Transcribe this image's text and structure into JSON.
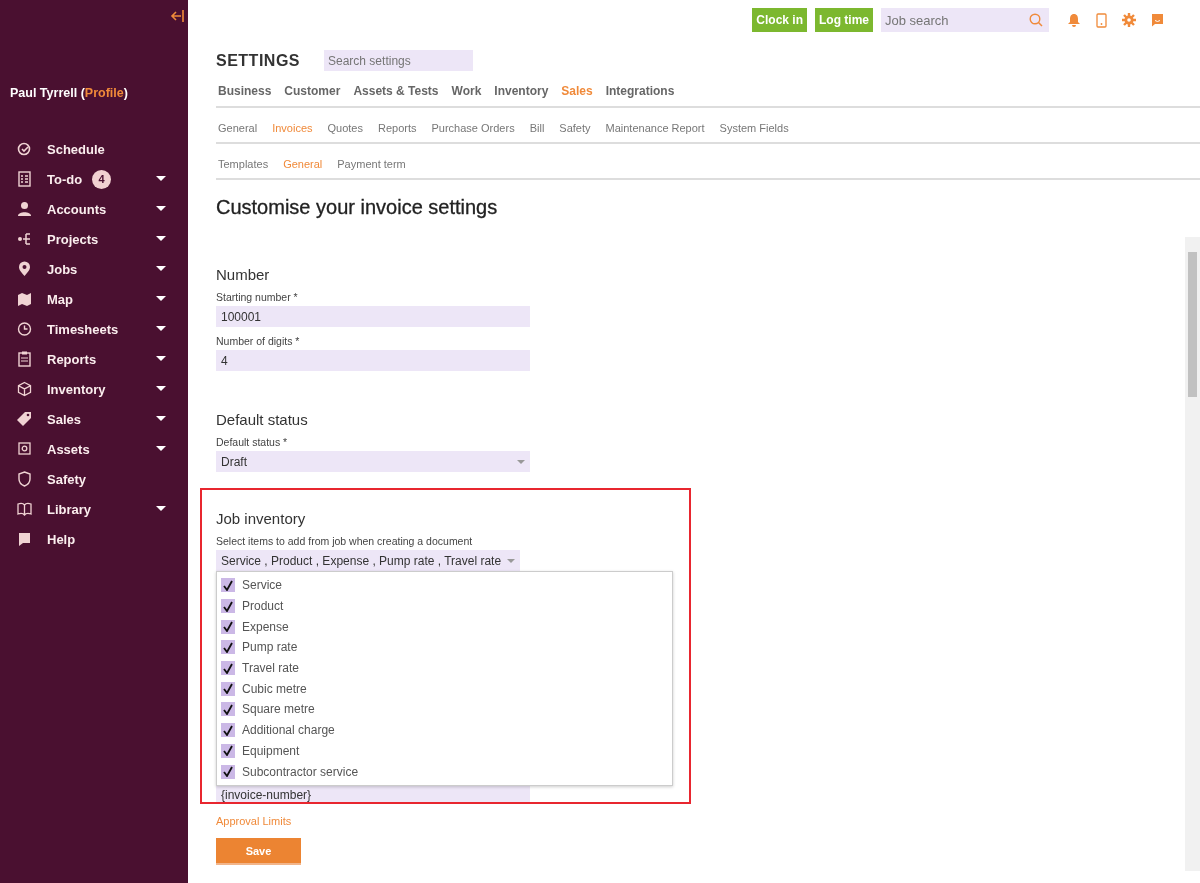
{
  "sidebar": {
    "user": {
      "before": "Paul Tyrrell (",
      "link": "Profile",
      "after": ")"
    },
    "items": [
      {
        "label": "Schedule",
        "has_menu": false
      },
      {
        "label": "To-do",
        "has_menu": true,
        "badge": "4"
      },
      {
        "label": "Accounts",
        "has_menu": true
      },
      {
        "label": "Projects",
        "has_menu": true
      },
      {
        "label": "Jobs",
        "has_menu": true
      },
      {
        "label": "Map",
        "has_menu": true
      },
      {
        "label": "Timesheets",
        "has_menu": true
      },
      {
        "label": "Reports",
        "has_menu": true
      },
      {
        "label": "Inventory",
        "has_menu": true
      },
      {
        "label": "Sales",
        "has_menu": true
      },
      {
        "label": "Assets",
        "has_menu": true
      },
      {
        "label": "Safety",
        "has_menu": false
      },
      {
        "label": "Library",
        "has_menu": true
      },
      {
        "label": "Help",
        "has_menu": false
      }
    ]
  },
  "topbar": {
    "buttons": [
      "Clock in",
      "Log time"
    ],
    "search": {
      "placeholder": "Job search"
    }
  },
  "settings": {
    "title": "SETTINGS",
    "search": {
      "placeholder": "Search settings"
    },
    "tabs": [
      {
        "label": "Business",
        "selected": false
      },
      {
        "label": "Customer",
        "selected": false
      },
      {
        "label": "Assets & Tests",
        "selected": false
      },
      {
        "label": "Work",
        "selected": false
      },
      {
        "label": "Inventory",
        "selected": false
      },
      {
        "label": "Sales",
        "selected": true
      },
      {
        "label": "Integrations",
        "selected": false
      }
    ],
    "subtabs": [
      {
        "label": "General",
        "selected": false
      },
      {
        "label": "Invoices",
        "selected": true
      },
      {
        "label": "Quotes",
        "selected": false
      },
      {
        "label": "Reports",
        "selected": false
      },
      {
        "label": "Purchase Orders",
        "selected": false
      },
      {
        "label": "Bill",
        "selected": false
      },
      {
        "label": "Safety",
        "selected": false
      },
      {
        "label": "Maintenance Report",
        "selected": false
      },
      {
        "label": "System Fields",
        "selected": false
      }
    ],
    "subsubtabs": [
      {
        "label": "Templates",
        "selected": false
      },
      {
        "label": "General",
        "selected": true
      },
      {
        "label": "Payment term",
        "selected": false
      }
    ],
    "heading": "Customise your invoice settings",
    "number": {
      "title": "Number",
      "fields": [
        {
          "label": "Starting number *",
          "value": "100001"
        },
        {
          "label": "Number of digits *",
          "value": "4"
        }
      ]
    },
    "default_status": {
      "title": "Default status",
      "label": "Default status *",
      "value": "Draft"
    },
    "job_inventory": {
      "title": "Job inventory",
      "label": "Select items to add from job when creating a document",
      "value": "Service , Product , Expense , Pump rate , Travel rate",
      "options": [
        {
          "label": "Service",
          "checked": true
        },
        {
          "label": "Product",
          "checked": true
        },
        {
          "label": "Expense",
          "checked": true
        },
        {
          "label": "Pump rate",
          "checked": true
        },
        {
          "label": "Travel rate",
          "checked": true
        },
        {
          "label": "Cubic metre",
          "checked": true
        },
        {
          "label": "Square metre",
          "checked": true
        },
        {
          "label": "Additional charge",
          "checked": true
        },
        {
          "label": "Equipment",
          "checked": true
        },
        {
          "label": "Subcontractor service",
          "checked": true
        }
      ],
      "hidden_field_value": "{invoice-number}"
    },
    "link": "Approval Limits",
    "save": "Save"
  }
}
